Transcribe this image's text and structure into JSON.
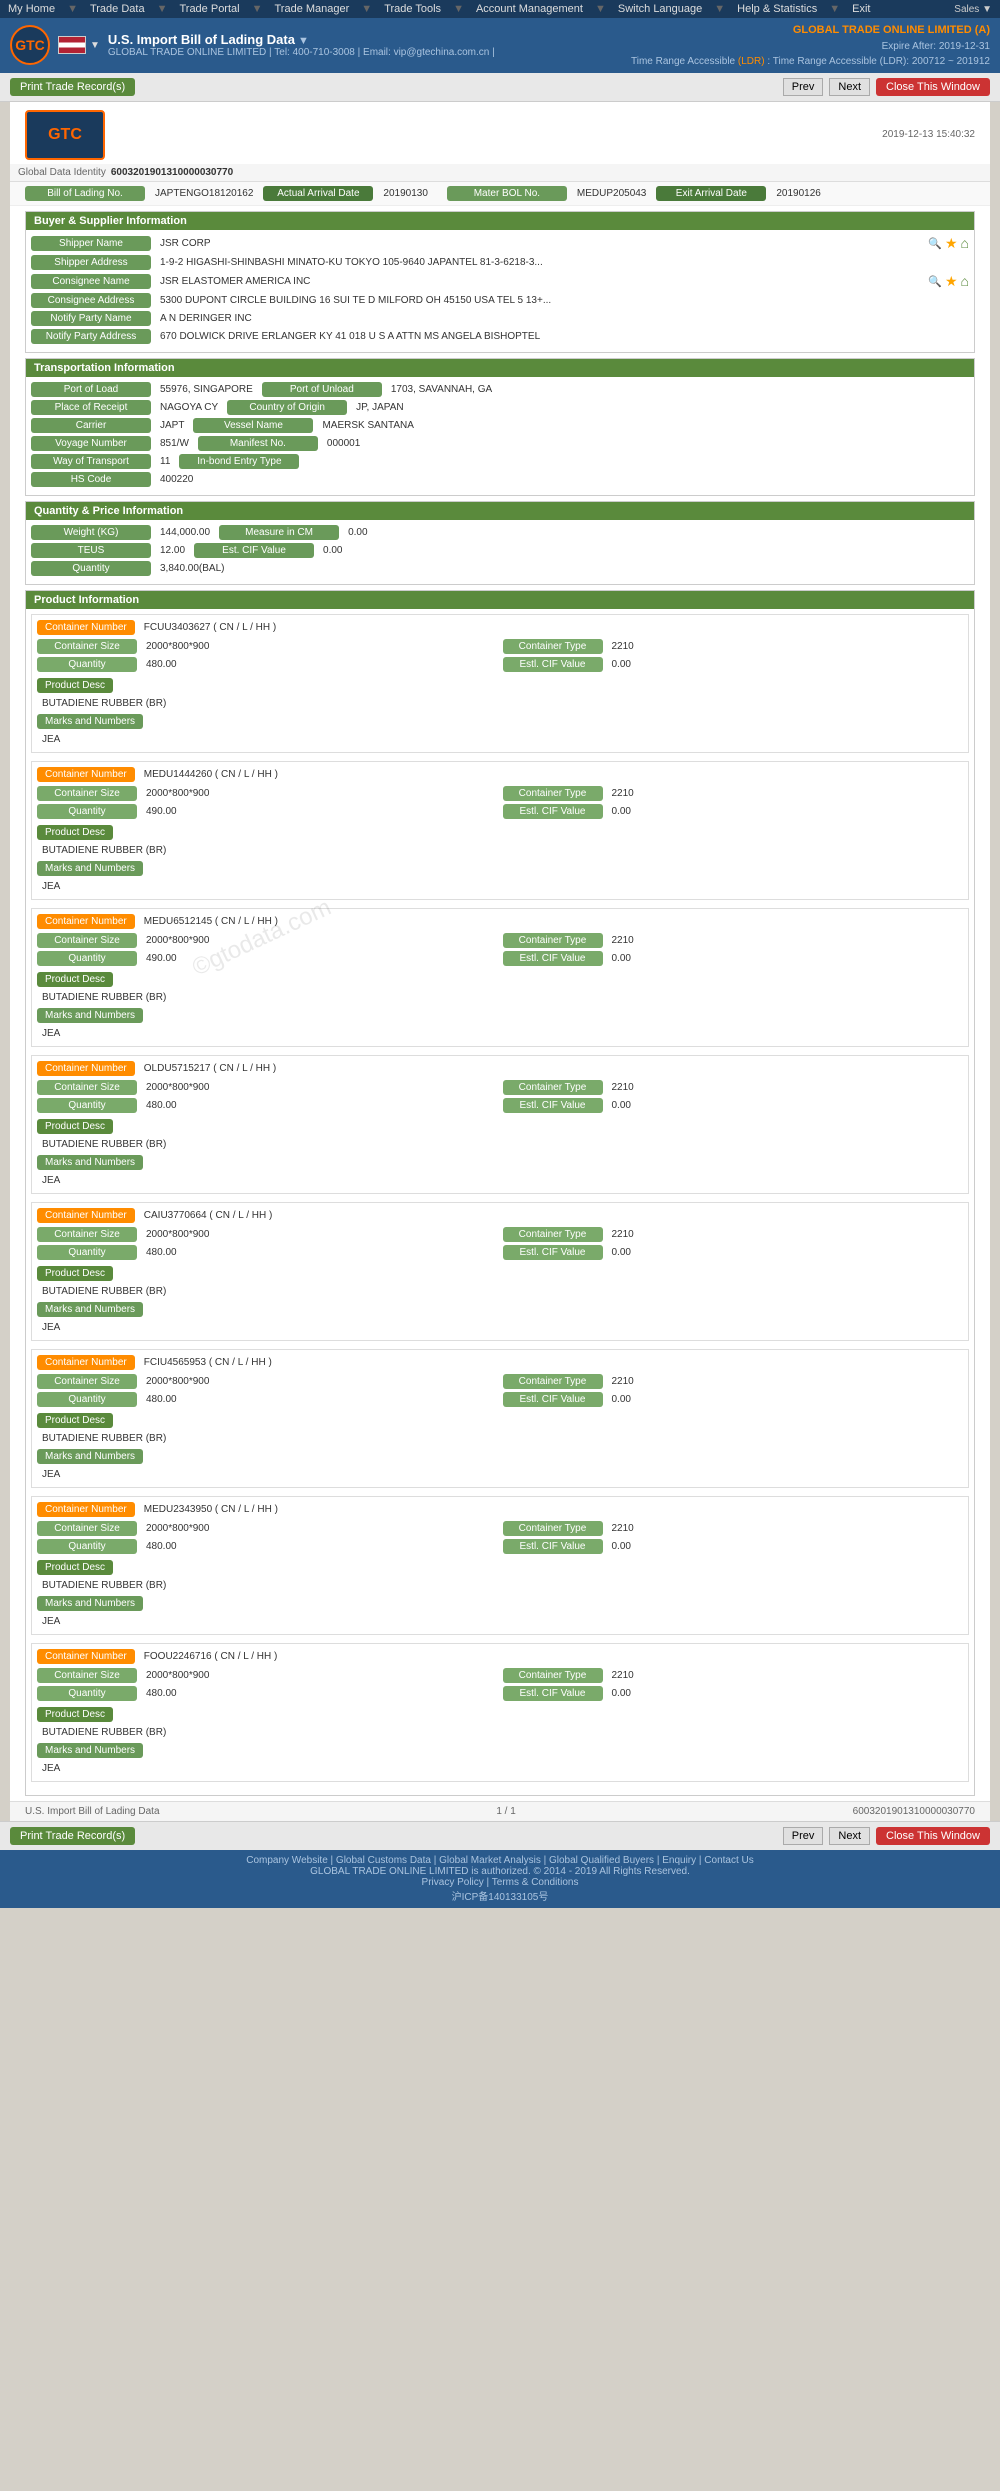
{
  "nav": {
    "items": [
      "My Home",
      "Trade Data",
      "Trade Portal",
      "Trade Manager",
      "Trade Tools",
      "Account Management",
      "Switch Language",
      "Help & Statistics",
      "Exit"
    ],
    "sales": "Sales"
  },
  "header": {
    "logo_text": "GTC",
    "page_title": "U.S. Import Bill of Lading Data",
    "page_title_dropdown": "▼",
    "subtitle": "GLOBAL TRADE ONLINE LIMITED | Tel: 400-710-3008 | Email: vip@gtechina.com.cn |",
    "company_name": "GLOBAL TRADE ONLINE LIMITED (A)",
    "expire": "Expire After: 2019-12-31",
    "time_range": "Time Range Accessible (LDR): 200712 ~ 201912"
  },
  "toolbar": {
    "print_btn": "Print Trade Record(s)",
    "prev_btn": "Prev",
    "next_btn": "Next",
    "close_btn": "Close This Window"
  },
  "doc": {
    "timestamp": "2019-12-13 15:40:32",
    "global_data_identity_label": "Global Data Identity",
    "global_data_identity_value": "6003201901310000030770",
    "bill_of_lading_label": "Bill of Lading No.",
    "bill_of_lading_value": "JAPTENGO18120162",
    "actual_arrival_date_label": "Actual Arrival Date",
    "actual_arrival_date_value": "20190130",
    "mater_bol_label": "Mater BOL No.",
    "mater_bol_value": "MEDUP205043",
    "exit_arrival_date_label": "Exit Arrival Date",
    "exit_arrival_date_value": "20190126"
  },
  "buyer_supplier": {
    "section_title": "Buyer & Supplier Information",
    "shipper_name_label": "Shipper Name",
    "shipper_name_value": "JSR CORP",
    "shipper_address_label": "Shipper Address",
    "shipper_address_value": "1-9-2 HIGASHI-SHINBASHI MINATO-KU TOKYO 105-9640 JAPANTEL 81-3-6218-3...",
    "consignee_name_label": "Consignee Name",
    "consignee_name_value": "JSR ELASTOMER AMERICA INC",
    "consignee_address_label": "Consignee Address",
    "consignee_address_value": "5300 DUPONT CIRCLE BUILDING 16 SUI TE D MILFORD OH 45150 USA TEL 5 13+...",
    "notify_party_label": "Notify Party Name",
    "notify_party_value": "A N DERINGER INC",
    "notify_party_address_label": "Notify Party Address",
    "notify_party_address_value": "670 DOLWICK DRIVE ERLANGER KY 41 018 U S A ATTN MS ANGELA BISHOPTEL"
  },
  "transportation": {
    "section_title": "Transportation Information",
    "port_of_load_label": "Port of Load",
    "port_of_load_value": "55976, SINGAPORE",
    "port_of_unload_label": "Port of Unload",
    "port_of_unload_value": "1703, SAVANNAH, GA",
    "place_of_receipt_label": "Place of Receipt",
    "place_of_receipt_value": "NAGOYA CY",
    "country_of_origin_label": "Country of Origin",
    "country_of_origin_value": "JP, JAPAN",
    "carrier_label": "Carrier",
    "carrier_value": "JAPT",
    "vessel_name_label": "Vessel Name",
    "vessel_name_value": "MAERSK SANTANA",
    "voyage_number_label": "Voyage Number",
    "voyage_number_value": "851/W",
    "manifest_no_label": "Manifest No.",
    "manifest_no_value": "000001",
    "way_of_transport_label": "Way of Transport",
    "way_of_transport_value": "11",
    "inbond_entry_label": "In-bond Entry Type",
    "inbond_entry_value": "",
    "hs_code_label": "HS Code",
    "hs_code_value": "400220"
  },
  "quantity_price": {
    "section_title": "Quantity & Price Information",
    "weight_label": "Weight (KG)",
    "weight_value": "144,000.00",
    "measure_label": "Measure in CM",
    "measure_value": "0.00",
    "teus_label": "TEUS",
    "teus_value": "12.00",
    "est_cif_label": "Est. CIF Value",
    "est_cif_value": "0.00",
    "quantity_label": "Quantity",
    "quantity_value": "3,840.00(BAL)"
  },
  "product_info": {
    "section_title": "Product Information",
    "containers": [
      {
        "id": "c1",
        "number_label": "Container Number",
        "number_value": "FCUU3403627 ( CN / L / HH )",
        "size_label": "Container Size",
        "size_value": "2000*800*900",
        "type_label": "Container Type",
        "type_value": "2210",
        "qty_label": "Quantity",
        "qty_value": "480.00",
        "est_cif_label": "Estl. CIF Value",
        "est_cif_value": "0.00",
        "product_desc_label": "Product Desc",
        "product_desc_value": "BUTADIENE RUBBER (BR)",
        "marks_label": "Marks and Numbers",
        "marks_value": "JEA"
      },
      {
        "id": "c2",
        "number_label": "Container Number",
        "number_value": "MEDU1444260 ( CN / L / HH )",
        "size_label": "Container Size",
        "size_value": "2000*800*900",
        "type_label": "Container Type",
        "type_value": "2210",
        "qty_label": "Quantity",
        "qty_value": "490.00",
        "est_cif_label": "Estl. CIF Value",
        "est_cif_value": "0.00",
        "product_desc_label": "Product Desc",
        "product_desc_value": "BUTADIENE RUBBER (BR)",
        "marks_label": "Marks and Numbers",
        "marks_value": "JEA"
      },
      {
        "id": "c3",
        "number_label": "Container Number",
        "number_value": "MEDU6512145 ( CN / L / HH )",
        "size_label": "Container Size",
        "size_value": "2000*800*900",
        "type_label": "Container Type",
        "type_value": "2210",
        "qty_label": "Quantity",
        "qty_value": "490.00",
        "est_cif_label": "Estl. CIF Value",
        "est_cif_value": "0.00",
        "product_desc_label": "Product Desc",
        "product_desc_value": "BUTADIENE RUBBER (BR)",
        "marks_label": "Marks and Numbers",
        "marks_value": "JEA"
      },
      {
        "id": "c4",
        "number_label": "Container Number",
        "number_value": "OLDU5715217 ( CN / L / HH )",
        "size_label": "Container Size",
        "size_value": "2000*800*900",
        "type_label": "Container Type",
        "type_value": "2210",
        "qty_label": "Quantity",
        "qty_value": "480.00",
        "est_cif_label": "Estl. CIF Value",
        "est_cif_value": "0.00",
        "product_desc_label": "Product Desc",
        "product_desc_value": "BUTADIENE RUBBER (BR)",
        "marks_label": "Marks and Numbers",
        "marks_value": "JEA"
      },
      {
        "id": "c5",
        "number_label": "Container Number",
        "number_value": "CAIU3770664 ( CN / L / HH )",
        "size_label": "Container Size",
        "size_value": "2000*800*900",
        "type_label": "Container Type",
        "type_value": "2210",
        "qty_label": "Quantity",
        "qty_value": "480.00",
        "est_cif_label": "Estl. CIF Value",
        "est_cif_value": "0.00",
        "product_desc_label": "Product Desc",
        "product_desc_value": "BUTADIENE RUBBER (BR)",
        "marks_label": "Marks and Numbers",
        "marks_value": "JEA"
      },
      {
        "id": "c6",
        "number_label": "Container Number",
        "number_value": "FCIU4565953 ( CN / L / HH )",
        "size_label": "Container Size",
        "size_value": "2000*800*900",
        "type_label": "Container Type",
        "type_value": "2210",
        "qty_label": "Quantity",
        "qty_value": "480.00",
        "est_cif_label": "Estl. CIF Value",
        "est_cif_value": "0.00",
        "product_desc_label": "Product Desc",
        "product_desc_value": "BUTADIENE RUBBER (BR)",
        "marks_label": "Marks and Numbers",
        "marks_value": "JEA"
      },
      {
        "id": "c7",
        "number_label": "Container Number",
        "number_value": "MEDU2343950 ( CN / L / HH )",
        "size_label": "Container Size",
        "size_value": "2000*800*900",
        "type_label": "Container Type",
        "type_value": "2210",
        "qty_label": "Quantity",
        "qty_value": "480.00",
        "est_cif_label": "Estl. CIF Value",
        "est_cif_value": "0.00",
        "product_desc_label": "Product Desc",
        "product_desc_value": "BUTADIENE RUBBER (BR)",
        "marks_label": "Marks and Numbers",
        "marks_value": "JEA"
      },
      {
        "id": "c8",
        "number_label": "Container Number",
        "number_value": "FOOU2246716 ( CN / L / HH )",
        "size_label": "Container Size",
        "size_value": "2000*800*900",
        "type_label": "Container Type",
        "type_value": "2210",
        "qty_label": "Quantity",
        "qty_value": "480.00",
        "est_cif_label": "Estl. CIF Value",
        "est_cif_value": "0.00",
        "product_desc_label": "Product Desc",
        "product_desc_value": "BUTADIENE RUBBER (BR)",
        "marks_label": "Marks and Numbers",
        "marks_value": "JEA"
      }
    ]
  },
  "doc_footer": {
    "data_source": "U.S. Import Bill of Lading Data",
    "page_info": "1 / 1",
    "footer_id": "6003201901310000030770"
  },
  "bottom_toolbar": {
    "print_btn": "Print Trade Record(s)",
    "prev_btn": "Prev",
    "next_btn": "Next",
    "close_btn": "Close This Window"
  },
  "site_footer": {
    "copyright": "GLOBAL TRADE ONLINE LIMITED is authorized. © 2014 - 2019 All Rights Reserved.",
    "links": [
      "Company Website",
      "Global Customs Data",
      "Global Market Analysis",
      "Global Qualified Buyers",
      "Enquiry",
      "Contact Us",
      "Privacy Policy",
      "Terms & Conditions"
    ],
    "icp": "沪ICP备140133105号"
  }
}
